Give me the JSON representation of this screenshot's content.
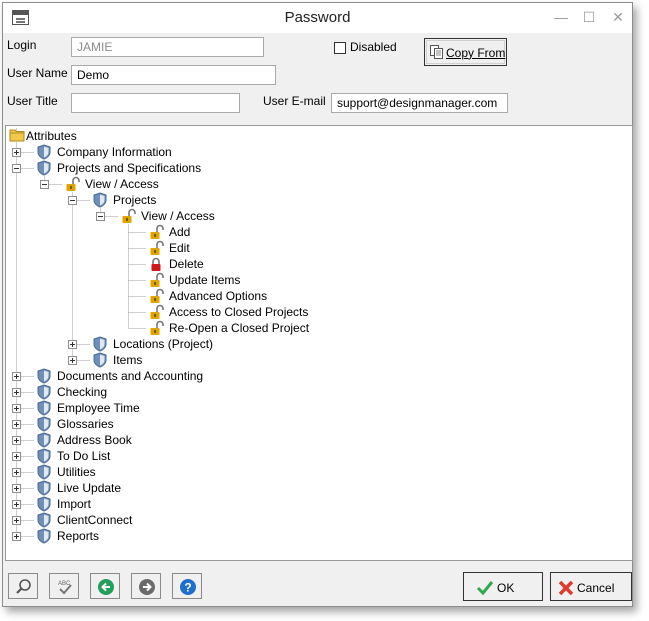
{
  "window": {
    "title": "Password"
  },
  "form": {
    "login_label": "Login",
    "login_value": "JAMIE",
    "disabled_label": "Disabled",
    "disabled_checked": false,
    "copy_from_label": "Copy From",
    "user_name_label": "User Name",
    "user_name_value": "Demo",
    "user_title_label": "User Title",
    "user_title_value": "",
    "user_email_label": "User E-mail",
    "user_email_value": "support@designmanager.com"
  },
  "tree": {
    "root": "Attributes",
    "nodes": [
      {
        "label": "Company Information",
        "level": 1,
        "icon": "shield-icon",
        "expander": "plus"
      },
      {
        "label": "Projects and Specifications",
        "level": 1,
        "icon": "shield-icon",
        "expander": "minus"
      },
      {
        "label": "View / Access",
        "level": 2,
        "icon": "lock-open-icon",
        "expander": "minus"
      },
      {
        "label": "Projects",
        "level": 3,
        "icon": "shield-icon",
        "expander": "minus"
      },
      {
        "label": "View / Access",
        "level": 4,
        "icon": "lock-open-icon",
        "expander": "minus"
      },
      {
        "label": "Add",
        "level": 5,
        "icon": "lock-open-icon",
        "expander": "none"
      },
      {
        "label": "Edit",
        "level": 5,
        "icon": "lock-open-icon",
        "expander": "none"
      },
      {
        "label": "Delete",
        "level": 5,
        "icon": "lock-closed-icon",
        "expander": "none"
      },
      {
        "label": "Update Items",
        "level": 5,
        "icon": "lock-open-icon",
        "expander": "none"
      },
      {
        "label": "Advanced Options",
        "level": 5,
        "icon": "lock-open-icon",
        "expander": "none"
      },
      {
        "label": "Access to Closed Projects",
        "level": 5,
        "icon": "lock-open-icon",
        "expander": "none"
      },
      {
        "label": "Re-Open a Closed Project",
        "level": 5,
        "icon": "lock-open-icon",
        "expander": "none"
      },
      {
        "label": "Locations (Project)",
        "level": 3,
        "icon": "shield-icon",
        "expander": "plus"
      },
      {
        "label": "Items",
        "level": 3,
        "icon": "shield-icon",
        "expander": "plus"
      },
      {
        "label": "Documents and Accounting",
        "level": 1,
        "icon": "shield-icon",
        "expander": "plus"
      },
      {
        "label": "Checking",
        "level": 1,
        "icon": "shield-icon",
        "expander": "plus"
      },
      {
        "label": "Employee Time",
        "level": 1,
        "icon": "shield-icon",
        "expander": "plus"
      },
      {
        "label": "Glossaries",
        "level": 1,
        "icon": "shield-icon",
        "expander": "plus"
      },
      {
        "label": "Address Book",
        "level": 1,
        "icon": "shield-icon",
        "expander": "plus"
      },
      {
        "label": "To Do List",
        "level": 1,
        "icon": "shield-icon",
        "expander": "plus"
      },
      {
        "label": "Utilities",
        "level": 1,
        "icon": "shield-icon",
        "expander": "plus"
      },
      {
        "label": "Live Update",
        "level": 1,
        "icon": "shield-icon",
        "expander": "plus"
      },
      {
        "label": "Import",
        "level": 1,
        "icon": "shield-icon",
        "expander": "plus"
      },
      {
        "label": "ClientConnect",
        "level": 1,
        "icon": "shield-icon",
        "expander": "plus"
      },
      {
        "label": "Reports",
        "level": 1,
        "icon": "shield-icon",
        "expander": "plus"
      }
    ]
  },
  "toolbar": {
    "buttons": [
      {
        "name": "find-button",
        "icon": "magnifier-icon"
      },
      {
        "name": "spellcheck-button",
        "icon": "spellcheck-icon"
      },
      {
        "name": "previous-button",
        "icon": "arrow-left-icon"
      },
      {
        "name": "next-button",
        "icon": "arrow-right-icon"
      },
      {
        "name": "help-button",
        "icon": "help-icon"
      }
    ],
    "ok_label": "OK",
    "cancel_label": "Cancel"
  },
  "colors": {
    "ok_check": "#2fa84f",
    "cancel_x": "#e03a2f",
    "lock_open": "#e0a400",
    "lock_closed": "#d01818",
    "shield": "#6f8fb8",
    "help": "#1c6fcc",
    "nav_green": "#22a05a",
    "nav_gray": "#6b6b6b"
  }
}
